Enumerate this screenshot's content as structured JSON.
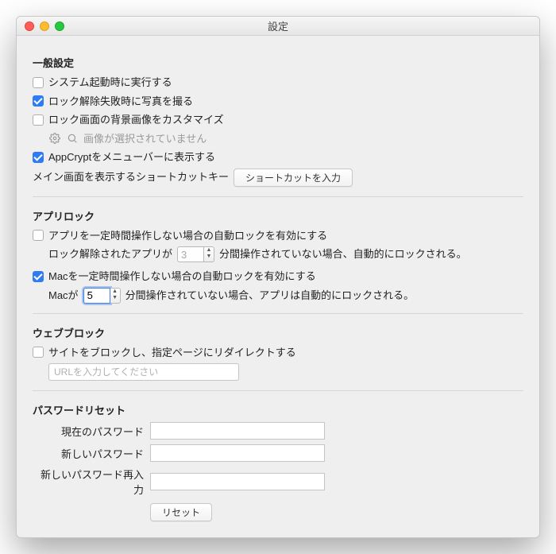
{
  "window": {
    "title": "設定"
  },
  "general": {
    "heading": "一般設定",
    "run_at_login": {
      "checked": false,
      "label": "システム起動時に実行する"
    },
    "photo_on_fail": {
      "checked": true,
      "label": "ロック解除失敗時に写真を撮る"
    },
    "custom_bg": {
      "checked": false,
      "label": "ロック画面の背景画像をカスタマイズ"
    },
    "bg_hint": "画像が選択されていません",
    "show_menubar": {
      "checked": true,
      "label": "AppCryptをメニューバーに表示する"
    },
    "shortcut_label": "メイン画面を表示するショートカットキー",
    "shortcut_button": "ショートカットを入力"
  },
  "applock": {
    "heading": "アプリロック",
    "app_idle": {
      "checked": false,
      "label": "アプリを一定時間操作しない場合の自動ロックを有効にする"
    },
    "app_idle_minutes": "3",
    "app_idle_prefix": "ロック解除されたアプリが",
    "app_idle_suffix": "分間操作されていない場合、自動的にロックされる。",
    "mac_idle": {
      "checked": true,
      "label": "Macを一定時間操作しない場合の自動ロックを有効にする"
    },
    "mac_idle_minutes": "5",
    "mac_idle_prefix": "Macが",
    "mac_idle_suffix": "分間操作されていない場合、アプリは自動的にロックされる。"
  },
  "webblock": {
    "heading": "ウェブブロック",
    "enable": {
      "checked": false,
      "label": "サイトをブロックし、指定ページにリダイレクトする"
    },
    "url_placeholder": "URLを入力してください"
  },
  "password": {
    "heading": "パスワードリセット",
    "current_label": "現在のパスワード",
    "new_label": "新しいパスワード",
    "confirm_label": "新しいパスワード再入力",
    "reset_button": "リセット"
  }
}
